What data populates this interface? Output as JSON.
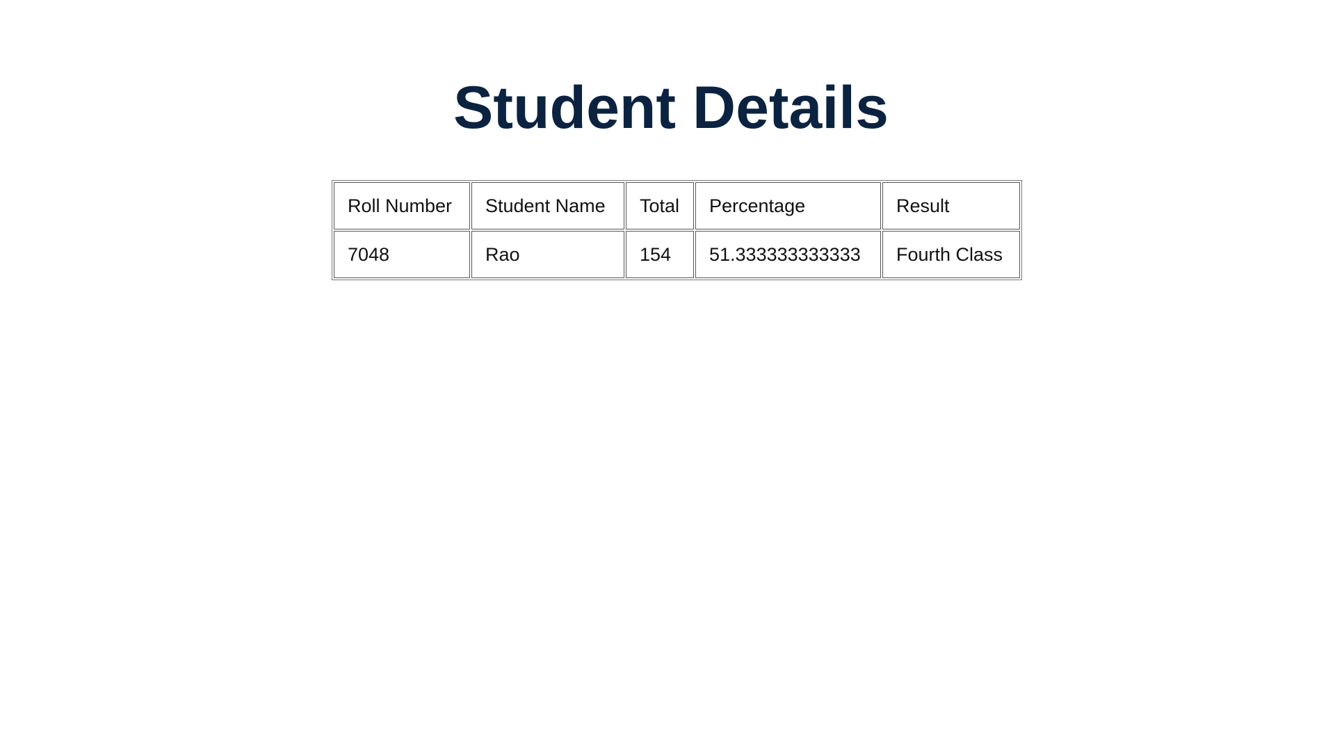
{
  "page": {
    "title": "Student Details",
    "title_color": "#0b2340"
  },
  "table": {
    "headers": {
      "roll_number": "Roll Number",
      "student_name": "Student Name",
      "total": "Total",
      "percentage": "Percentage",
      "result": "Result"
    },
    "rows": [
      {
        "roll_number": "7048",
        "student_name": "Rao",
        "total": "154",
        "percentage": "51.333333333333",
        "result": "Fourth Class"
      }
    ]
  }
}
